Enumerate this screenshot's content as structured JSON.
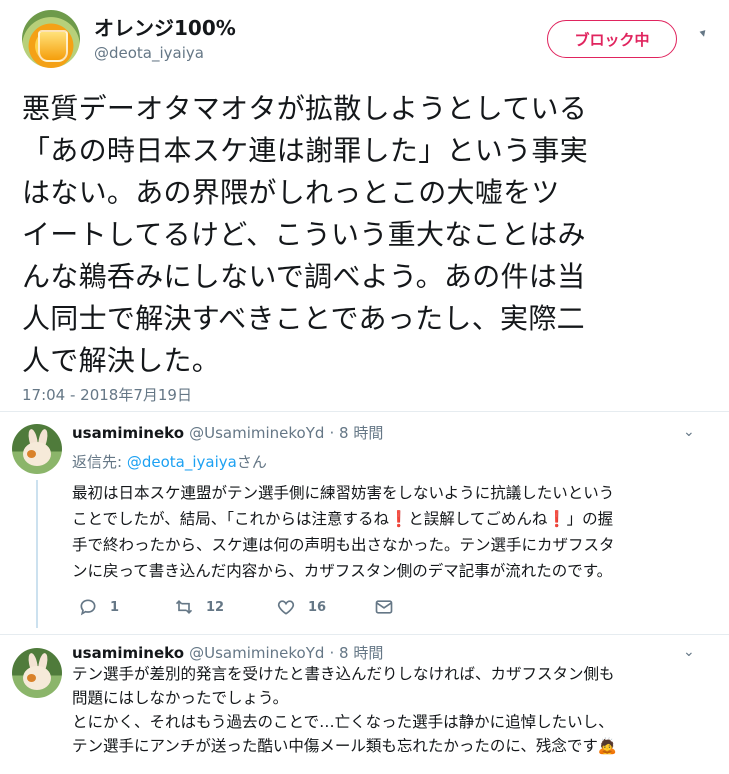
{
  "tweet": {
    "display_name": "オレンジ100%",
    "handle": "@deota_iyaiya",
    "block_label": "ブロック中",
    "text": "悪質デーオタマオタが拡散しようとしている\n「あの時日本スケ連は謝罪した」という事実\nはない。あの界隈がしれっとこの大嘘をツ\nイートしてるけど、こういう重大なことはみ\nんな鵜呑みにしないで調べよう。あの件は当\n人同士で解決すべきことであったし、実際二\n人で解決した。",
    "timestamp": "17:04 - 2018年7月19日"
  },
  "replies": [
    {
      "name": "usamimineko",
      "handle": "@UsamiminekoYd",
      "time": "· 8 時間",
      "reply_to_prefix": "返信先: ",
      "reply_to_mention": "@deota_iyaiya",
      "reply_to_suffix": "さん",
      "text_1": "最初は日本スケ連盟がテン選手側に練習妨害をしないように抗議したいという\nことでしたが、結局、「これからは注意するね",
      "bang": "❗",
      "text_2": "と誤解してごめんね",
      "text_3": "」の握\n手で終わったから、スケ連は何の声明も出さなかった。テン選手にカザフスタ\nンに戻って書き込んだ内容から、カザフスタン側のデマ記事が流れたのです。",
      "reply_count": "1",
      "retweet_count": "12",
      "like_count": "16"
    },
    {
      "name": "usamimineko",
      "handle": "@UsamiminekoYd",
      "time": "· 8 時間",
      "text": "テン選手が差別的発言を受けたと書き込んだりしなければ、カザフスタン側も\n問題にはしなかったでしょう。\nとにかく、それはもう過去のことで…亡くなった選手は静かに追悼したいし、\nテン選手にアンチが送った酷い中傷メール類も忘れたかったのに、残念です",
      "emoji": "🙇"
    }
  ],
  "icons": [
    "reply-icon",
    "retweet-icon",
    "like-icon",
    "message-icon",
    "chevron-down-icon"
  ],
  "colors": {
    "accent": "#1da1f2",
    "block_red": "#e0245e",
    "muted": "#657786"
  }
}
